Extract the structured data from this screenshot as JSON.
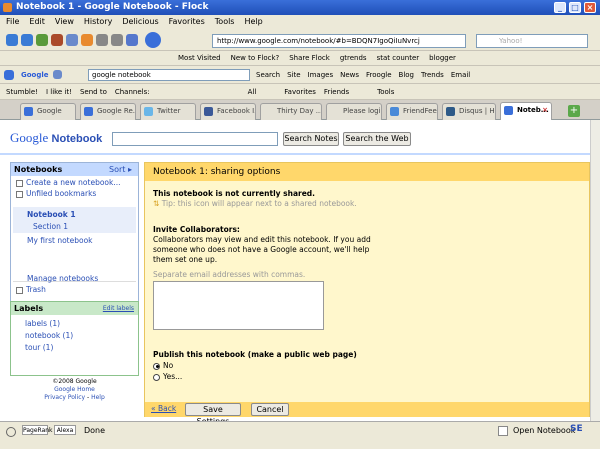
{
  "window": {
    "title": "Notebook 1 - Google Notebook - Flock"
  },
  "menu": [
    "File",
    "Edit",
    "View",
    "History",
    "Delicious",
    "Favorites",
    "Tools",
    "Help"
  ],
  "nav": {
    "url": "http://www.google.com/notebook/#b=BDQN7IgoQiIuNvrcj",
    "search_placeholder": "Yahoo!"
  },
  "bookmarks": [
    "Most Visited",
    "New to Flock?",
    "Share Flock",
    "gtrends",
    "stat counter",
    "blogger"
  ],
  "google_toolbar": {
    "brand": "Google",
    "search_value": "google notebook",
    "items": [
      "Search",
      "Site",
      "Images",
      "News",
      "Froogle",
      "Blog",
      "Trends",
      "Email"
    ]
  },
  "stumble_toolbar": {
    "items": [
      "Stumble!",
      "I like it!",
      "Send to",
      "Channels:",
      "All",
      "Favorites",
      "Friends",
      "Tools"
    ]
  },
  "tabs": [
    "Google",
    "Google Re...",
    "Twitter",
    "Facebook I...",
    "Thirty Day ...",
    "Please login",
    "FriendFeed",
    "Disqus | He...",
    "Noteb..."
  ],
  "page": {
    "logo_google": "Google",
    "logo_product": "Notebook",
    "search_notes_label": "Search Notes",
    "search_web_label": "Search the Web"
  },
  "sidebar": {
    "notebooks_header": "Notebooks",
    "sort_label": "Sort",
    "create_link": "Create a new notebook...",
    "unfiled_link": "Unfiled bookmarks",
    "notebook1": "Notebook 1",
    "section1": "Section 1",
    "my_first": "My first notebook",
    "manage_link": "Manage notebooks",
    "trash_link": "Trash",
    "labels_header": "Labels",
    "edit_labels": "Edit labels",
    "labels": [
      "labels (1)",
      "notebook (1)",
      "tour (1)"
    ],
    "footer": {
      "copyright": "©2008 Google",
      "home": "Google Home",
      "privacy": "Privacy Policy",
      "sep": " - ",
      "help": "Help"
    }
  },
  "share": {
    "title": "Notebook 1: sharing options",
    "not_shared": "This notebook is not currently shared.",
    "tip": "Tip: this icon will appear next to a shared notebook.",
    "invite_heading": "Invite Collaborators:",
    "invite_desc_1": "Collaborators may view and edit this notebook. If you add",
    "invite_desc_2": "someone who does not have a Google account, we'll help",
    "invite_desc_3": "them set one up.",
    "email_hint": "Separate email addresses with commas.",
    "publish_heading": "Publish this notebook (make a public web page)",
    "option_no": "No",
    "option_yes": "Yes...",
    "back_label": "« Back",
    "save_label": "Save Settings",
    "cancel_label": "Cancel"
  },
  "status": {
    "pagerank": "PageRank",
    "alexa": "Alexa",
    "text": "Done",
    "open_notebook": "Open Notebook"
  }
}
